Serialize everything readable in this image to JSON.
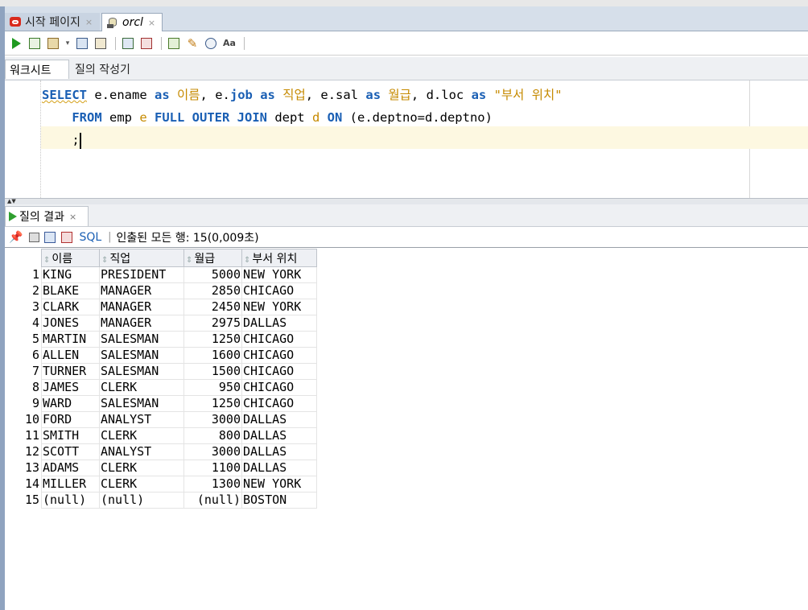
{
  "doc_tabs": [
    {
      "label": "시작 페이지",
      "close": "×"
    },
    {
      "label": "orcl",
      "close": "×"
    }
  ],
  "worksheet_tabs": [
    {
      "label": "워크시트"
    },
    {
      "label": "질의 작성기"
    }
  ],
  "editor": {
    "line1": {
      "select": "SELECT",
      "p1": " e.ename ",
      "as1": "as",
      "a1": " 이름",
      "p2": ", e.",
      "job": "job",
      "p3": " ",
      "as2": "as",
      "a2": " 직업",
      "p4": ", e.sal ",
      "as3": "as",
      "a3": " 월급",
      "p5": ", d.loc ",
      "as4": "as",
      "s4": " \"부서 위치\""
    },
    "line2": {
      "from": "FROM",
      "p1": " emp ",
      "e": "e",
      "join": " FULL OUTER JOIN",
      "p2": " dept ",
      "d": "d",
      "on": " ON",
      "p3": " (e.deptno=d.deptno)"
    },
    "line3": ";"
  },
  "results_tab": {
    "label": "질의 결과",
    "close": "×"
  },
  "results_toolbar": {
    "sql_label": "SQL",
    "separator": "|",
    "status": "인출된 모든 행: 15(0,009초)"
  },
  "grid": {
    "columns": [
      "이름",
      "직업",
      "월급",
      "부서 위치"
    ],
    "rows": [
      {
        "n": "1",
        "name": "KING",
        "job": "PRESIDENT",
        "sal": "5000",
        "loc": "NEW YORK"
      },
      {
        "n": "2",
        "name": "BLAKE",
        "job": "MANAGER",
        "sal": "2850",
        "loc": "CHICAGO"
      },
      {
        "n": "3",
        "name": "CLARK",
        "job": "MANAGER",
        "sal": "2450",
        "loc": "NEW YORK"
      },
      {
        "n": "4",
        "name": "JONES",
        "job": "MANAGER",
        "sal": "2975",
        "loc": "DALLAS"
      },
      {
        "n": "5",
        "name": "MARTIN",
        "job": "SALESMAN",
        "sal": "1250",
        "loc": "CHICAGO"
      },
      {
        "n": "6",
        "name": "ALLEN",
        "job": "SALESMAN",
        "sal": "1600",
        "loc": "CHICAGO"
      },
      {
        "n": "7",
        "name": "TURNER",
        "job": "SALESMAN",
        "sal": "1500",
        "loc": "CHICAGO"
      },
      {
        "n": "8",
        "name": "JAMES",
        "job": "CLERK",
        "sal": "950",
        "loc": "CHICAGO"
      },
      {
        "n": "9",
        "name": "WARD",
        "job": "SALESMAN",
        "sal": "1250",
        "loc": "CHICAGO"
      },
      {
        "n": "10",
        "name": "FORD",
        "job": "ANALYST",
        "sal": "3000",
        "loc": "DALLAS"
      },
      {
        "n": "11",
        "name": "SMITH",
        "job": "CLERK",
        "sal": "800",
        "loc": "DALLAS"
      },
      {
        "n": "12",
        "name": "SCOTT",
        "job": "ANALYST",
        "sal": "3000",
        "loc": "DALLAS"
      },
      {
        "n": "13",
        "name": "ADAMS",
        "job": "CLERK",
        "sal": "1100",
        "loc": "DALLAS"
      },
      {
        "n": "14",
        "name": "MILLER",
        "job": "CLERK",
        "sal": "1300",
        "loc": "NEW YORK"
      },
      {
        "n": "15",
        "name": "(null)",
        "job": "(null)",
        "sal": "(null)",
        "loc": "BOSTON"
      }
    ]
  },
  "colors": {
    "keyword": "#1a5fb4",
    "alias": "#c68a00",
    "oracle_red": "#d92a1c",
    "current_line": "#fdf8e1"
  }
}
